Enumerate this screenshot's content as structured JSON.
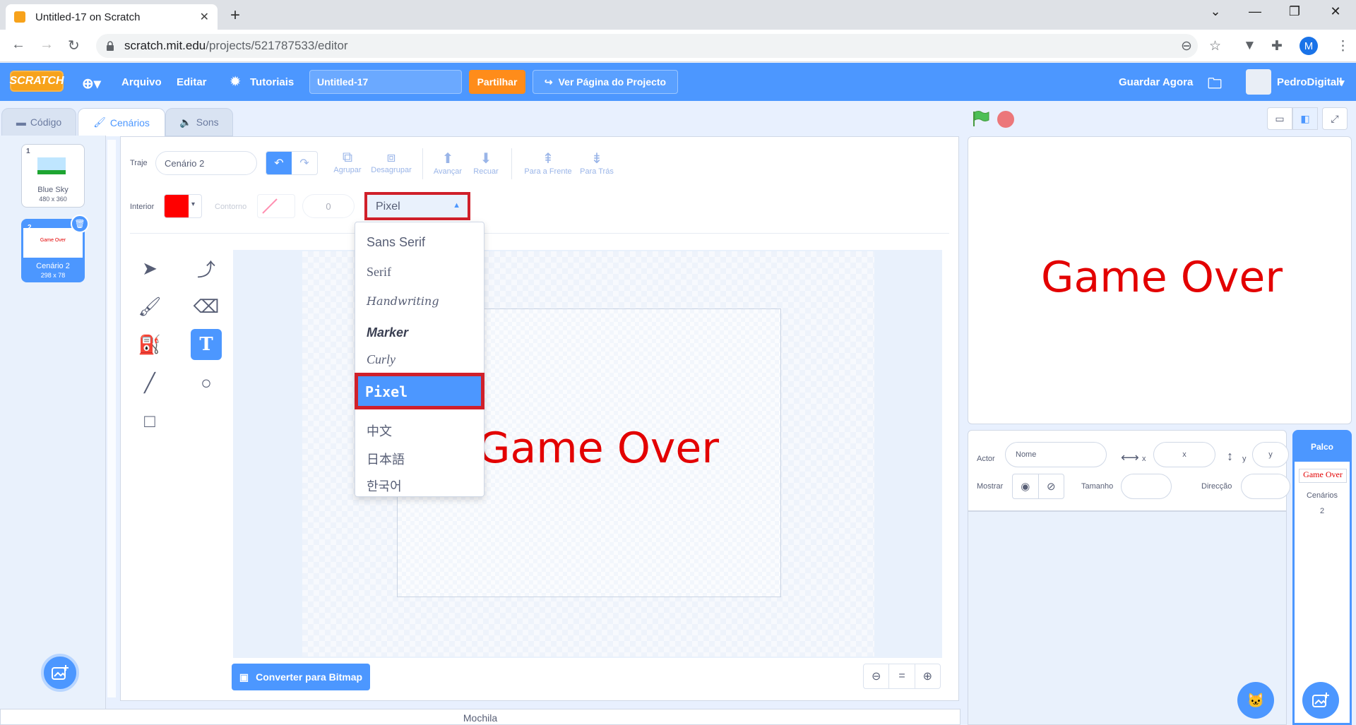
{
  "browser": {
    "tab_title": "Untitled-17 on Scratch",
    "url_host": "scratch.mit.edu",
    "url_path": "/projects/521787533/editor",
    "profile_initial": "M"
  },
  "menubar": {
    "logo": "SCRATCH",
    "file": "Arquivo",
    "edit": "Editar",
    "tutorials": "Tutoriais",
    "project_title": "Untitled-17",
    "share": "Partilhar",
    "see_project_page": "Ver Página do Projecto",
    "save_now": "Guardar Agora",
    "username": "PedroDigitall"
  },
  "editor_tabs": {
    "code": "Código",
    "costumes": "Cenários",
    "sounds": "Sons"
  },
  "costumes": [
    {
      "num": "1",
      "name": "Blue Sky",
      "size": "480 x 360"
    },
    {
      "num": "2",
      "name": "Cenário 2",
      "size": "298 x 78",
      "thumb_text": "Game Over"
    }
  ],
  "paint": {
    "costume_label": "Traje",
    "costume_name": "Cenário 2",
    "group": "Agrupar",
    "ungroup": "Desagrupar",
    "forward": "Avançar",
    "backward": "Recuar",
    "front": "Para a Frente",
    "back": "Para Trás",
    "fill_label": "Interior",
    "outline_label": "Contorno",
    "outline_width": "0",
    "font_selected": "Pixel",
    "canvas_text": "Game Over",
    "convert_bitmap": "Converter para Bitmap",
    "zoom_reset": "="
  },
  "font_menu": {
    "items": [
      "Sans Serif",
      "Serif",
      "Handwriting",
      "Marker",
      "Curly",
      "Pixel",
      "中文",
      "日本語",
      "한국어"
    ],
    "selected": "Pixel"
  },
  "colors": {
    "accent": "#4c97ff",
    "fill": "#ff0000",
    "highlight_border": "#d0202a",
    "text_red": "#e30000"
  },
  "stage": {
    "text": "Game Over"
  },
  "sprite_info": {
    "sprite_label": "Actor",
    "name_placeholder": "Nome",
    "x_label": "x",
    "x_placeholder": "x",
    "y_label": "y",
    "y_placeholder": "y",
    "show_label": "Mostrar",
    "size_label": "Tamanho",
    "direction_label": "Direcção"
  },
  "stage_panel": {
    "title": "Palco",
    "thumb_text": "Game Over",
    "backdrops_label": "Cenários",
    "backdrops_count": "2"
  },
  "backpack": "Mochila"
}
